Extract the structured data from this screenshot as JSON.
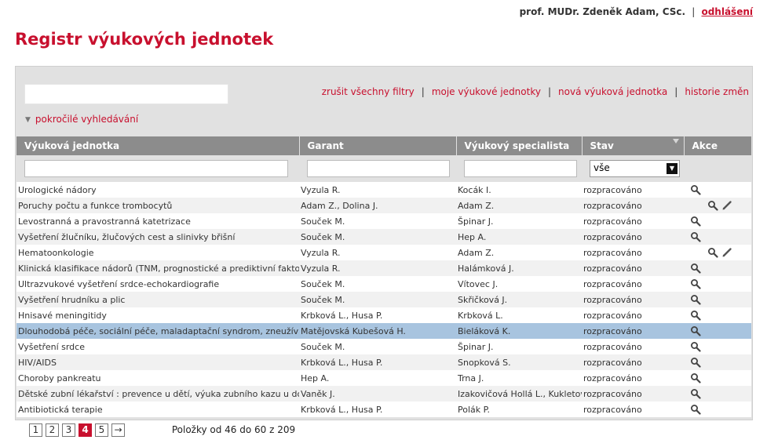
{
  "user": {
    "name": "prof. MUDr. Zdeněk Adam, CSc.",
    "separator": "|",
    "logout_label": "odhlášení"
  },
  "page_title": "Registr výukových jednotek",
  "search": {
    "placeholder": "",
    "value": ""
  },
  "links": [
    {
      "label": "zrušit všechny filtry"
    },
    {
      "label": "moje výukové jednotky"
    },
    {
      "label": "nová výuková jednotka"
    },
    {
      "label": "historie změn"
    }
  ],
  "advanced_search_label": "pokročilé vyhledávání",
  "columns": [
    "Výuková jednotka",
    "Garant",
    "Výukový specialista",
    "Stav",
    "Akce"
  ],
  "filters": {
    "status_value": "vše"
  },
  "rows": [
    {
      "unit": "Urologické nádory",
      "garant": "Vyzula R.",
      "specialist": "Kocák I.",
      "status": "rozpracováno",
      "actions": [
        "view"
      ]
    },
    {
      "unit": "Poruchy počtu a funkce trombocytů",
      "garant": "Adam Z., Dolina J.",
      "specialist": "Adam Z.",
      "status": "rozpracováno",
      "actions": [
        "view",
        "edit"
      ]
    },
    {
      "unit": "Levostranná a pravostranná katetrizace",
      "garant": "Souček M.",
      "specialist": "Špinar J.",
      "status": "rozpracováno",
      "actions": [
        "view"
      ]
    },
    {
      "unit": "Vyšetření žlučníku, žlučových cest a slinivky břišní",
      "garant": "Souček M.",
      "specialist": "Hep A.",
      "status": "rozpracováno",
      "actions": [
        "view"
      ]
    },
    {
      "unit": "Hematoonkologie",
      "garant": "Vyzula R.",
      "specialist": "Adam Z.",
      "status": "rozpracováno",
      "actions": [
        "view",
        "edit"
      ]
    },
    {
      "unit": "Klinická klasifikace nádorů (TNM, prognostické a prediktivní faktory)",
      "garant": "Vyzula R.",
      "specialist": "Halámková J.",
      "status": "rozpracováno",
      "actions": [
        "view"
      ]
    },
    {
      "unit": "Ultrazvukové vyšetření srdce-echokardiografie",
      "garant": "Souček M.",
      "specialist": "Vítovec J.",
      "status": "rozpracováno",
      "actions": [
        "view"
      ]
    },
    {
      "unit": "Vyšetření hrudníku a plic",
      "garant": "Souček M.",
      "specialist": "Skřičková J.",
      "status": "rozpracováno",
      "actions": [
        "view"
      ]
    },
    {
      "unit": "Hnisavé meningitidy",
      "garant": "Krbková L., Husa P.",
      "specialist": "Krbková L.",
      "status": "rozpracováno",
      "actions": [
        "view"
      ]
    },
    {
      "unit": "Dlouhodobá péče, sociální péče, maladaptační syndrom, zneužívání seniorů",
      "garant": "Matějovská Kubešová H.",
      "specialist": "Bieláková K.",
      "status": "rozpracováno",
      "actions": [
        "view"
      ],
      "selected": true
    },
    {
      "unit": "Vyšetření srdce",
      "garant": "Souček M.",
      "specialist": "Špinar J.",
      "status": "rozpracováno",
      "actions": [
        "view"
      ]
    },
    {
      "unit": "HIV/AIDS",
      "garant": "Krbková L., Husa P.",
      "specialist": "Snopková S.",
      "status": "rozpracováno",
      "actions": [
        "view"
      ]
    },
    {
      "unit": "Choroby pankreatu",
      "garant": "Hep A.",
      "specialist": "Trna J.",
      "status": "rozpracováno",
      "actions": [
        "view"
      ]
    },
    {
      "unit": "Dětské zubní lékařství : prevence u dětí, výuka zubního kazu u dočasných",
      "garant": "Vaněk J.",
      "specialist": "Izakovičová Hollá L., Kukletová M.",
      "status": "rozpracováno",
      "actions": [
        "view"
      ]
    },
    {
      "unit": "Antibiotická terapie",
      "garant": "Krbková L., Husa P.",
      "specialist": "Polák P.",
      "status": "rozpracováno",
      "actions": [
        "view"
      ]
    }
  ],
  "pagination": {
    "pages": [
      "1",
      "2",
      "3",
      "4",
      "5"
    ],
    "current": "4",
    "next_label": "→",
    "info": "Položky od 46 do 60 z 209"
  },
  "colors": {
    "accent": "#c8102e",
    "header_bg": "#8c8c8c",
    "panel_bg": "#e1e1e1",
    "selected_row": "#a8c4df"
  },
  "icons": {
    "view": "magnifier-icon",
    "edit": "pencil-icon",
    "sort": "sort-triangle-icon",
    "advanced": "chevron-down-icon",
    "dropdown": "dropdown-arrow-icon"
  }
}
